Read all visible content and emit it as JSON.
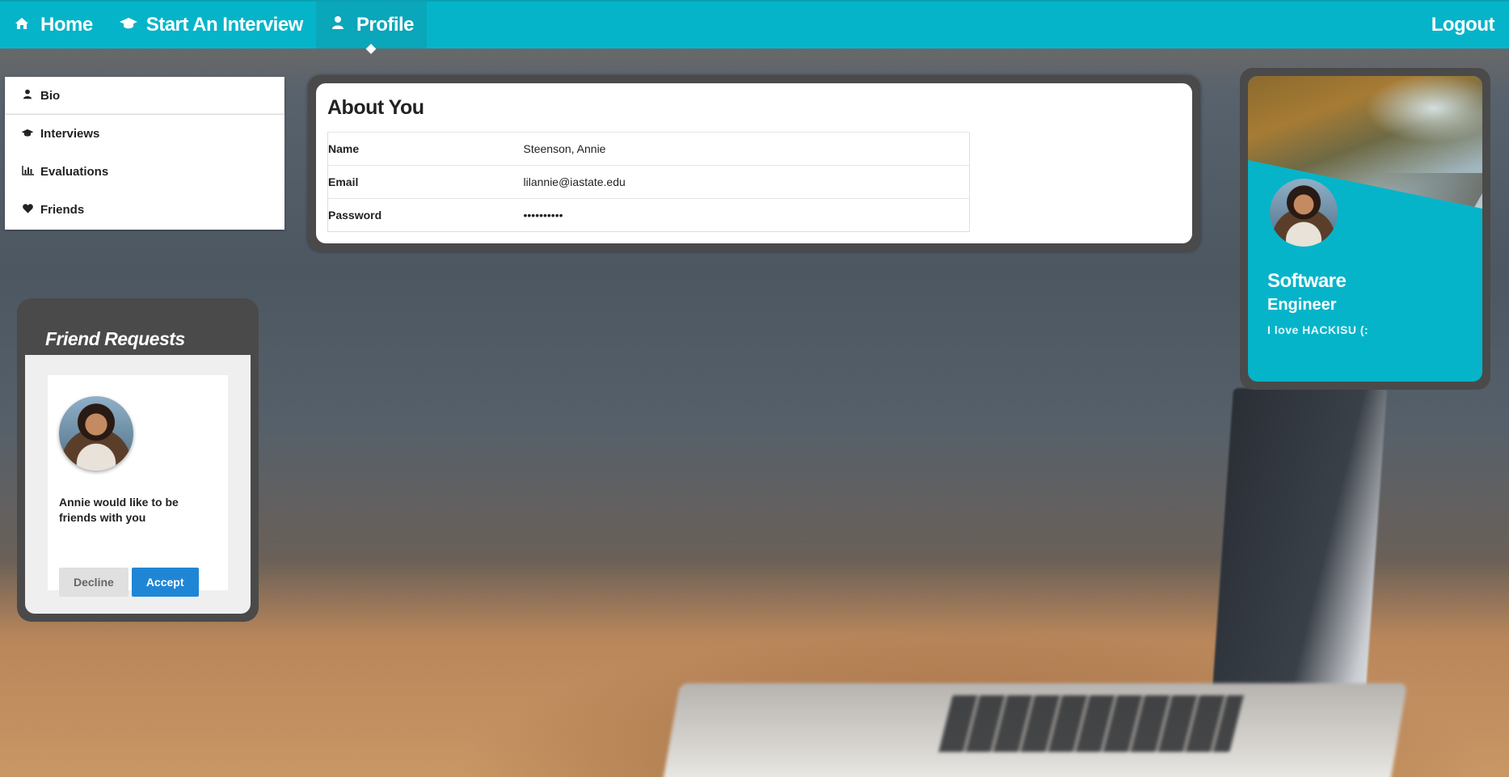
{
  "navbar": {
    "home": {
      "label": "Home",
      "icon": "home-icon"
    },
    "interview": {
      "label": "Start An Interview",
      "icon": "graduation-cap-icon"
    },
    "profile": {
      "label": "Profile",
      "icon": "user-icon"
    },
    "logout": "Logout",
    "color": "#06b4c9"
  },
  "sidebar": {
    "items": [
      {
        "label": "Bio",
        "icon": "user-icon"
      },
      {
        "label": "Interviews",
        "icon": "graduation-cap-icon"
      },
      {
        "label": "Evaluations",
        "icon": "bar-chart-icon"
      },
      {
        "label": "Friends",
        "icon": "heart-icon"
      }
    ]
  },
  "about": {
    "title": "About You",
    "rows": [
      {
        "key": "Name",
        "value": "Steenson, Annie"
      },
      {
        "key": "Email",
        "value": "lilannie@iastate.edu"
      },
      {
        "key": "Password",
        "value": "••••••••••"
      }
    ]
  },
  "profile_card": {
    "title_line1": "Software",
    "title_line2": "Engineer",
    "bio": "I love HACKISU (:"
  },
  "friend_requests": {
    "title": "Friend Requests",
    "message": "Annie would like to be friends with you",
    "decline": "Decline",
    "accept": "Accept"
  }
}
